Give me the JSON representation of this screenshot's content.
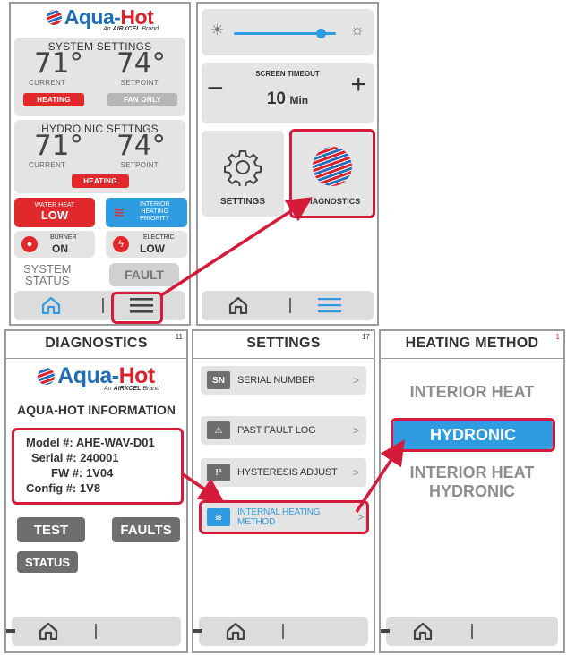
{
  "brand": {
    "name_a": "Aqua-",
    "name_b": "Hot",
    "sub_a": "An ",
    "sub_b": "AIRXCEL",
    "sub_c": " Brand",
    "trademark": "."
  },
  "home": {
    "system_settings": {
      "title": "SYSTEM SETTINGS",
      "current_temp": "71°",
      "current_label": "CURRENT",
      "setpoint_temp": "74°",
      "setpoint_label": "SETPOINT",
      "heating_label": "HEATING",
      "fan_only_label": "FAN ONLY"
    },
    "hydronic_settings": {
      "title": "HYDRO NIC SETTNGS",
      "current_temp": "71°",
      "current_label": "CURRENT",
      "setpoint_temp": "74°",
      "setpoint_label": "SETPOINT",
      "heating_label": "HEATING"
    },
    "water_heat": {
      "label": "WATER HEAT",
      "value": "LOW"
    },
    "interior_priority": {
      "line1": "INTERIOR",
      "line2": "HEATING",
      "line3": "PRIORITY"
    },
    "burner": {
      "label": "BURNER",
      "value": "ON"
    },
    "electric": {
      "label": "ELECTRIC",
      "value": "LOW"
    },
    "system_status": {
      "line1": "SYSTEM",
      "line2": "STATUS",
      "value": "FAULT"
    }
  },
  "menu": {
    "brightness_level": 0.85,
    "screen_timeout": {
      "label": "SCREEN TIMEOUT",
      "value": "10",
      "unit": "Min",
      "minus": "−",
      "plus": "+"
    },
    "settings_label": "SETTINGS",
    "diagnostics_label": "DIAGNOSTICS"
  },
  "diagnostics": {
    "title": "DIAGNOSTICS",
    "page_num": "11",
    "info_title": "AQUA-HOT INFORMATION",
    "model": "Model #: AHE-WAV-D01",
    "serial": "Serial #: 240001",
    "fw": "FW #: 1V04",
    "config": "Config #: 1V8",
    "test_label": "TEST",
    "faults_label": "FAULTS",
    "status_label": "STATUS"
  },
  "settings": {
    "title": "SETTINGS",
    "page_num": "17",
    "items": [
      {
        "icon": "SN",
        "label": "SERIAL NUMBER"
      },
      {
        "icon": "⚠",
        "label": "PAST FAULT LOG"
      },
      {
        "icon": "!°",
        "label": "HYSTERESIS ADJUST"
      },
      {
        "icon": "≋",
        "label": "INTERNAL HEATING METHOD"
      }
    ],
    "chevron": ">"
  },
  "heating_method": {
    "title": "HEATING METHOD",
    "page_num": "1",
    "options": [
      {
        "label": "INTERIOR HEAT"
      },
      {
        "label": "HYDRONIC"
      },
      {
        "label_line1": "INTERIOR HEAT",
        "label_line2": "HYDRONIC"
      }
    ]
  },
  "colors": {
    "red": "#e1282b",
    "blue": "#2f9be0",
    "highlight": "#d51a3a",
    "panel_gray": "#e4e4e4"
  }
}
